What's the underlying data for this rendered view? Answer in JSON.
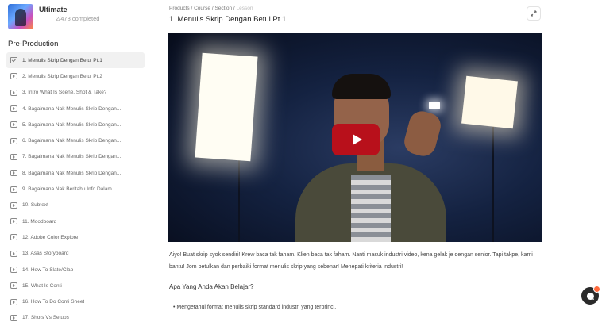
{
  "course": {
    "title": "Ultimate",
    "progress": "2/478 completed"
  },
  "sidebar": {
    "section_title": "Pre-Production",
    "lessons": [
      "1. Menulis Skrip Dengan Betul Pt.1",
      "2. Menulis Skrip Dengan Betul Pt.2",
      "3. Intro What Is Scene, Shot & Take?",
      "4. Bagaimana Nak Menulis Skrip Dengan...",
      "5. Bagaimana Nak Menulis Skrip Dengan...",
      "6. Bagaimana Nak Menulis Skrip Dengan...",
      "7. Bagaimana Nak Menulis Skrip Dengan...",
      "8. Bagaimana Nak Menulis Skrip Dengan...",
      "9. Bagaimana Nak Beritahu Info Dalam ...",
      "10. Subtext",
      "11. Moodboard",
      "12. Adobe Color Explore",
      "13. Asas Storyboard",
      "14. How To Slate/Clap",
      "15. What Is Conti",
      "16. How To Do Conti Sheet",
      "17. Shots Vs Setups"
    ],
    "active_index": 0
  },
  "breadcrumb": {
    "parts": "Products / Course / Section / ",
    "current": "Lesson"
  },
  "lesson": {
    "title": "1. Menulis Skrip Dengan Betul Pt.1",
    "description": "Aiyo! Buat skrip syok sendiri! Krew baca tak faham. Klien baca tak faham. Nanti masuk industri video, kena gelak je dengan senior. Tapi takpe, kami bantu! Jom betulkan dan perbaiki format menulis skrip yang sebenar! Menepati kriteria industri!",
    "learn_heading": "Apa Yang Anda Akan Belajar?",
    "learn_items": [
      "Mengetahui format menulis skrip standard industri yang terprinci."
    ]
  },
  "icons": {
    "expand": "expand-icon",
    "play": "play-icon",
    "chat": "chat-icon",
    "lesson_video": "video-icon",
    "lesson_done": "check-icon"
  },
  "colors": {
    "play_button": "#b8101b",
    "chat_badge": "#ff6a3d"
  }
}
